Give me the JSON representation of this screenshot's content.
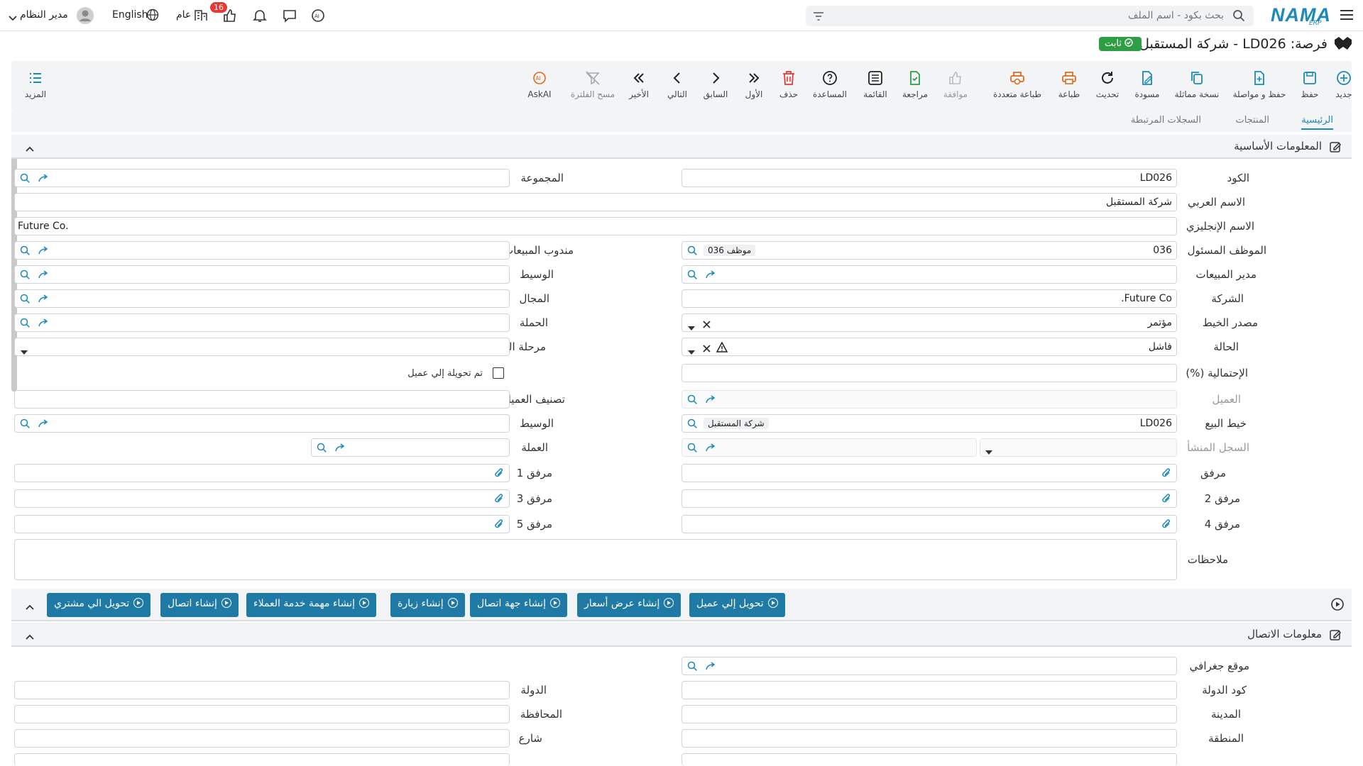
{
  "topbar": {
    "brand": "NAMA",
    "brand_sub": "ERP",
    "search_placeholder": "بحث بكود - اسم الملف",
    "user_name": "مدير النظام",
    "language": "English",
    "scope": "عام",
    "notif_count": "16"
  },
  "page": {
    "title": "فرصة: LD026 - شركة المستقبل",
    "status": "ثابت"
  },
  "toolbar": {
    "items": [
      "جديد",
      "حفظ",
      "حفظ و مواصلة",
      "نسخة مماثلة",
      "مسودة",
      "تحديث",
      "طباعة",
      "طباعة متعددة",
      "موافقة",
      "مراجعة",
      "القائمة",
      "المساعدة",
      "حذف",
      "الأول",
      "السابق",
      "التالي",
      "الأخير",
      "مسح الفلترة",
      "AskAI"
    ],
    "more": "المزيد"
  },
  "tabs": [
    "الرئيسية",
    "المنتجات",
    "السجلات المرتبطة"
  ],
  "basic": {
    "title": "المعلومات الأساسية",
    "labels": {
      "code": "الكود",
      "arabic_name": "الاسم العربي",
      "english_name": "الاسم الإنجليزي",
      "employee": "الموظف المسئول",
      "sales_manager": "مدير المبيعات",
      "company": "الشركة",
      "lead_source": "مصدر الخيط",
      "status": "الحالة",
      "probability": "الإحتمالية (%)",
      "customer": "العميل",
      "sales_lead": "خيط البيع",
      "origin_record": "السجل المنشأ",
      "attachment": "مرفق",
      "attachment2": "مرفق 2",
      "attachment4": "مرفق 4",
      "group": "المجموعة",
      "sales_rep": "مندوب المبيعات",
      "broker": "الوسيط",
      "field": "المجال",
      "campaign": "الحملة",
      "sales_stage": "مرحلة البيع",
      "converted": "تم تحويلة إلي عميل",
      "customer_class": "تصنيف العميل",
      "broker2": "الوسيط",
      "currency": "العملة",
      "attachment1": "مرفق 1",
      "attachment3": "مرفق 3",
      "attachment5": "مرفق 5",
      "notes": "ملاحظات"
    },
    "values": {
      "code": "LD026",
      "arabic_name": "شركة المستقبل",
      "english_name": "Future Co.",
      "employee_code": "036",
      "employee_chip": "موظف 036",
      "company": "Future Co.",
      "lead_source": "مؤتمر",
      "status": "فاشل",
      "sales_lead_code": "LD026",
      "sales_lead_chip": "شركة المستقبل"
    }
  },
  "actions": [
    "تحويل إلي عميل",
    "إنشاء عرض أسعار",
    "إنشاء جهة اتصال",
    "إنشاء زيارة",
    "إنشاء مهمة خدمة العملاء",
    "إنشاء اتصال",
    "تحويل الي مشتري"
  ],
  "contact": {
    "title": "معلومات الاتصال",
    "labels": {
      "geo": "موقع جغرافي",
      "country_code": "كود الدولة",
      "city": "المدينة",
      "area": "المنطقة",
      "country": "الدولة",
      "governorate": "المحافظة",
      "street": "شارع"
    }
  },
  "colors": {
    "accent": "#1b8ab8",
    "button": "#1f7aa6",
    "success": "#2e9e44",
    "danger": "#e53935"
  }
}
